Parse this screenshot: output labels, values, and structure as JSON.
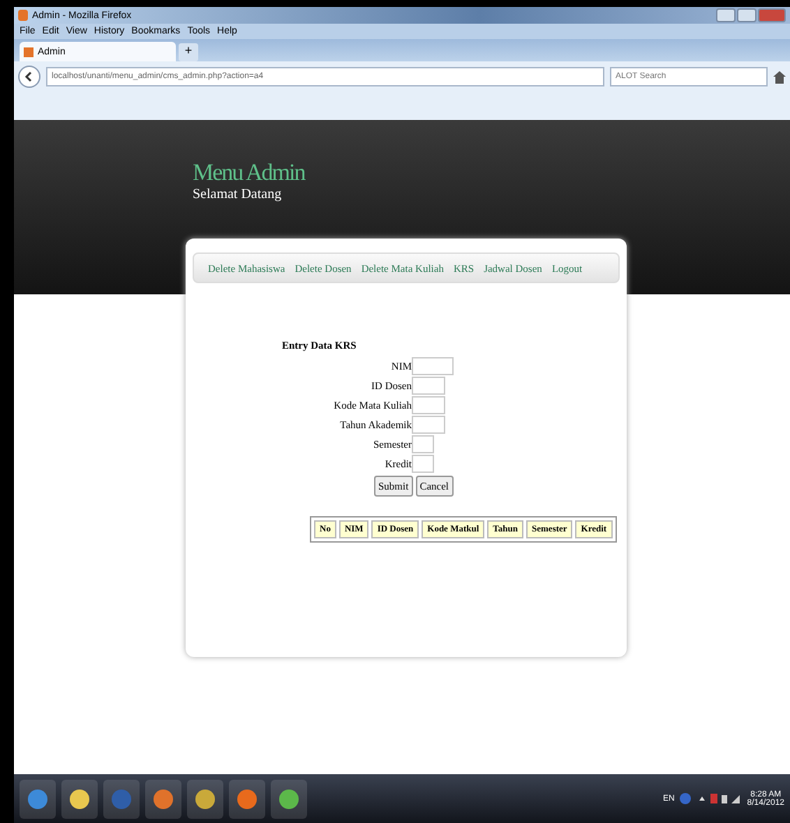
{
  "window": {
    "title": "Admin - Mozilla Firefox"
  },
  "menu": [
    "File",
    "Edit",
    "View",
    "History",
    "Bookmarks",
    "Tools",
    "Help"
  ],
  "tab": {
    "label": "Admin",
    "new_tab": "+"
  },
  "address_bar": {
    "value": "localhost/unanti/menu_admin/cms_admin.php?action=a4"
  },
  "search": {
    "placeholder": "ALOT Search"
  },
  "header": {
    "title": "Menu Admin",
    "subtitle": "Selamat Datang"
  },
  "nav": [
    "Delete Mahasiswa",
    "Delete Dosen",
    "Delete Mata Kuliah",
    "KRS",
    "Jadwal Dosen",
    "Logout"
  ],
  "form": {
    "title": "Entry Data KRS",
    "fields": [
      {
        "label": "NIM",
        "kind": "wide"
      },
      {
        "label": "ID Dosen",
        "kind": "medium"
      },
      {
        "label": "Kode Mata Kuliah",
        "kind": "medium"
      },
      {
        "label": "Tahun Akademik",
        "kind": "medium"
      },
      {
        "label": "Semester",
        "kind": "narrow"
      },
      {
        "label": "Kredit",
        "kind": "narrow"
      }
    ],
    "buttons": [
      "Submit",
      "Cancel"
    ]
  },
  "table": {
    "columns": [
      "No",
      "NIM",
      "ID Dosen",
      "Kode Matkul",
      "Tahun",
      "Semester",
      "Kredit"
    ]
  },
  "taskbar": {
    "language": "EN",
    "time": "8:28 AM",
    "date": "8/14/2012"
  }
}
